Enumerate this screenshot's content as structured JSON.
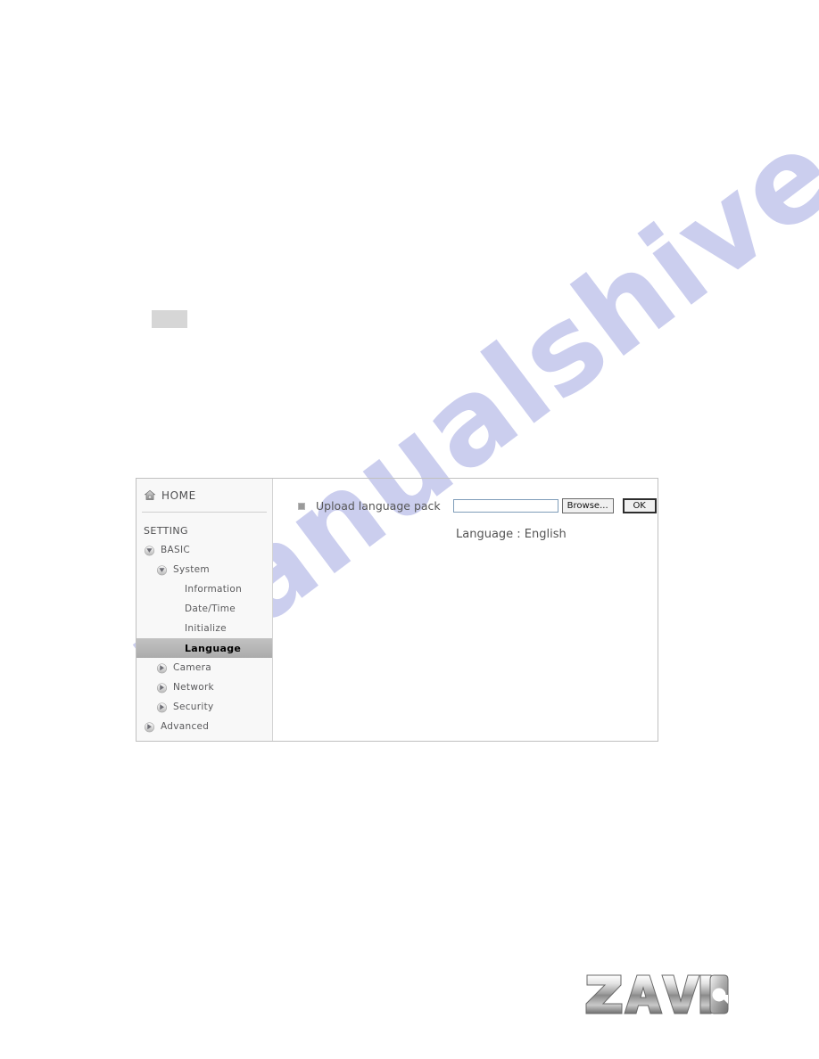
{
  "page": {
    "background_color": "#ffffff",
    "watermark_text": "manualshive.com",
    "watermark_color": "#c9ccee"
  },
  "panel": {
    "border_color": "#c0c0c0",
    "sidebar": {
      "background_color": "#f8f8f8",
      "home": {
        "label": "HOME",
        "icon": "home-icon"
      },
      "section_label": "SETTING",
      "items": [
        {
          "label": "BASIC",
          "level": 0,
          "icon": "chevron-down-badge-icon",
          "selected": false
        },
        {
          "label": "System",
          "level": 1,
          "icon": "chevron-down-badge-icon",
          "selected": false
        },
        {
          "label": "Information",
          "level": 2,
          "icon": "none",
          "selected": false
        },
        {
          "label": "Date/Time",
          "level": 2,
          "icon": "none",
          "selected": false
        },
        {
          "label": "Initialize",
          "level": 2,
          "icon": "none",
          "selected": false
        },
        {
          "label": "Language",
          "level": 2,
          "icon": "none",
          "selected": true
        },
        {
          "label": "Camera",
          "level": 1,
          "icon": "chevron-right-badge-icon",
          "selected": false
        },
        {
          "label": "Network",
          "level": 1,
          "icon": "chevron-right-badge-icon",
          "selected": false
        },
        {
          "label": "Security",
          "level": 1,
          "icon": "chevron-right-badge-icon",
          "selected": false
        },
        {
          "label": "Advanced",
          "level": 0,
          "icon": "chevron-right-badge-icon",
          "selected": false
        }
      ],
      "selected_item": "Language",
      "selected_background_color": "#b9b9b9"
    },
    "content": {
      "upload_row": {
        "bullet_icon": "square-bullet-icon",
        "label": "Upload language pack",
        "file_input_value": "",
        "file_input_placeholder": "",
        "browse_button_label": "Browse...",
        "ok_button_label": "OK"
      },
      "language_status": "Language : English"
    }
  },
  "branding": {
    "logo_text": "ZAVIO",
    "logo_colors": {
      "light": "#f2f2f2",
      "mid": "#b4b4b4",
      "dark": "#7a7a7a"
    }
  }
}
